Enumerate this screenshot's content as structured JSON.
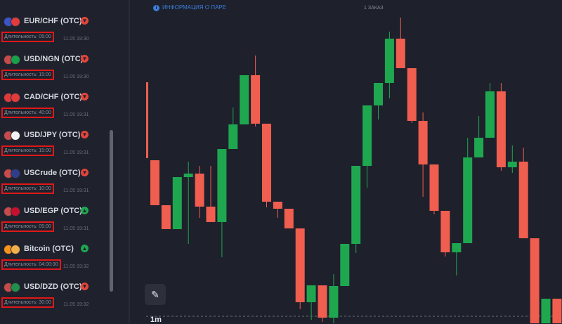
{
  "trades": [
    {
      "asset": "EUR/CHF (OTC)",
      "duration": "Длительность: 05:00",
      "time": "11.05 19:30",
      "direction": "down",
      "flag_left": "#3b55c9",
      "flag_right": "#e23b3b"
    },
    {
      "asset": "USD/NGN (OTC)",
      "duration": "Длительность: 15:00",
      "time": "11.05 19:30",
      "direction": "down",
      "flag_left": "#c84b4b",
      "flag_right": "#18a04a"
    },
    {
      "asset": "CAD/CHF (OTC)",
      "duration": "Длительность: 40:00",
      "time": "11.05 19:31",
      "direction": "down",
      "flag_left": "#e03a3a",
      "flag_right": "#e23b3b"
    },
    {
      "asset": "USD/JPY (OTC)",
      "duration": "Длительность: 15:00",
      "time": "11.05 19:31",
      "direction": "down",
      "flag_left": "#c84b4b",
      "flag_right": "#f2f2f2"
    },
    {
      "asset": "USCrude (OTC)",
      "duration": "Длительность: 10:00",
      "time": "11.05 19:31",
      "direction": "down",
      "flag_left": "#c84b4b",
      "flag_right": "#2f3d8a"
    },
    {
      "asset": "USD/EGP (OTC)",
      "duration": "Длительность: 05:00",
      "time": "11.05 19:31",
      "direction": "up",
      "flag_left": "#c84b4b",
      "flag_right": "#c8102e"
    },
    {
      "asset": "Bitcoin (OTC)",
      "duration": "Длительность: 04:00:00",
      "time": "11.05 19:32",
      "direction": "up",
      "flag_left": "#f7931a",
      "flag_right": "#f0b04a"
    },
    {
      "asset": "USD/DZD (OTC)",
      "duration": "Длительность: 30:00",
      "time": "11.05 19:32",
      "direction": "down",
      "flag_left": "#c84b4b",
      "flag_right": "#1f8f4a"
    }
  ],
  "chart": {
    "info_link": "ИНФОРМАЦИЯ О ПАРЕ",
    "timer_badge": "1 ЗАКАЗ",
    "timeframe": "1m",
    "colors": {
      "up": "#1fa750",
      "down": "#ef5e4f",
      "background": "#1e202c"
    },
    "y_range": [
      0,
      460
    ],
    "candles": [
      {
        "o": 228,
        "c": 292,
        "h": 228,
        "l": 292
      },
      {
        "o": 292,
        "c": 326,
        "h": 292,
        "l": 326
      },
      {
        "o": 326,
        "c": 252,
        "h": 252,
        "l": 326
      },
      {
        "o": 252,
        "c": 247,
        "h": 230,
        "l": 347
      },
      {
        "o": 247,
        "c": 294,
        "h": 236,
        "l": 310
      },
      {
        "o": 294,
        "c": 316,
        "h": 236,
        "l": 316
      },
      {
        "o": 316,
        "c": 212,
        "h": 212,
        "l": 366
      },
      {
        "o": 212,
        "c": 177,
        "h": 153,
        "l": 212
      },
      {
        "o": 177,
        "c": 107,
        "h": 107,
        "l": 177
      },
      {
        "o": 107,
        "c": 176,
        "h": 79,
        "l": 180
      },
      {
        "o": 176,
        "c": 287,
        "h": 176,
        "l": 295
      },
      {
        "o": 287,
        "c": 297,
        "h": 287,
        "l": 310
      },
      {
        "o": 297,
        "c": 325,
        "h": 297,
        "l": 325
      },
      {
        "o": 325,
        "c": 430,
        "h": 325,
        "l": 440
      },
      {
        "o": 430,
        "c": 406,
        "h": 406,
        "l": 455
      },
      {
        "o": 406,
        "c": 452,
        "h": 406,
        "l": 458
      },
      {
        "o": 452,
        "c": 407,
        "h": 390,
        "l": 460
      },
      {
        "o": 407,
        "c": 347,
        "h": 347,
        "l": 407
      },
      {
        "o": 347,
        "c": 236,
        "h": 236,
        "l": 360
      },
      {
        "o": 236,
        "c": 150,
        "h": 150,
        "l": 267
      },
      {
        "o": 150,
        "c": 118,
        "h": 118,
        "l": 170
      },
      {
        "o": 118,
        "c": 55,
        "h": 45,
        "l": 140
      },
      {
        "o": 55,
        "c": 97,
        "h": 25,
        "l": 97
      },
      {
        "o": 97,
        "c": 172,
        "h": 97,
        "l": 175
      },
      {
        "o": 172,
        "c": 234,
        "h": 160,
        "l": 280
      },
      {
        "o": 234,
        "c": 300,
        "h": 234,
        "l": 305
      },
      {
        "o": 300,
        "c": 359,
        "h": 300,
        "l": 365
      },
      {
        "o": 359,
        "c": 346,
        "h": 346,
        "l": 392
      },
      {
        "o": 346,
        "c": 224,
        "h": 196,
        "l": 346
      },
      {
        "o": 224,
        "c": 196,
        "h": 165,
        "l": 224
      },
      {
        "o": 196,
        "c": 130,
        "h": 118,
        "l": 196
      },
      {
        "o": 130,
        "c": 238,
        "h": 118,
        "l": 243
      },
      {
        "o": 238,
        "c": 230,
        "h": 207,
        "l": 246
      },
      {
        "o": 230,
        "c": 339,
        "h": 210,
        "l": 339
      },
      {
        "o": 339,
        "c": 460,
        "h": 339,
        "l": 460
      },
      {
        "o": 460,
        "c": 425,
        "h": 425,
        "l": 460
      },
      {
        "o": 425,
        "c": 460,
        "h": 425,
        "l": 460
      }
    ]
  }
}
